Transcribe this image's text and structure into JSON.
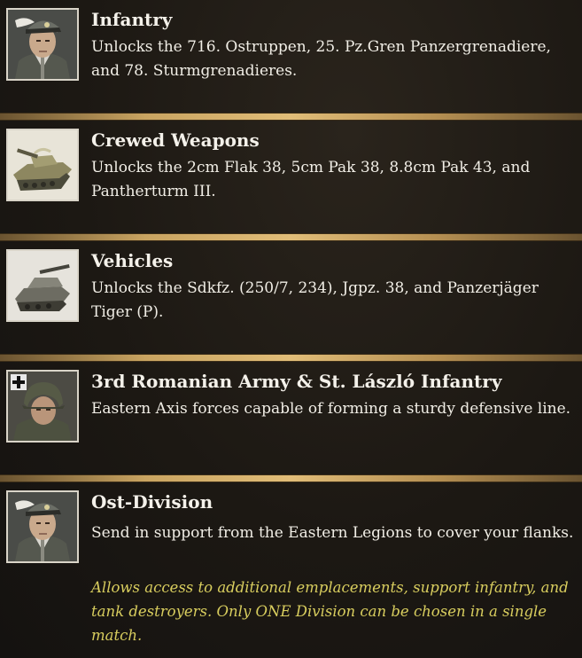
{
  "items": [
    {
      "icon": "officer-portrait-icon",
      "title": "Infantry",
      "description": "Unlocks the 716. Ostruppen, 25. Pz.Gren Panzergrenadiere, and 78. Sturmgrenadieres."
    },
    {
      "icon": "tank-icon",
      "title": "Crewed Weapons",
      "description": "Unlocks the 2cm Flak 38, 5cm Pak 38, 8.8cm Pak 43, and Pantherturm III."
    },
    {
      "icon": "tank-destroyer-icon",
      "title": "Vehicles",
      "description": "Unlocks the Sdkfz. (250/7, 234), Jgpz. 38, and Panzerjäger Tiger (P)."
    },
    {
      "icon": "soldier-portrait-icon",
      "title": "3rd Romanian Army & St. László Infantry",
      "description": "Eastern Axis forces capable of forming a sturdy defensive line."
    },
    {
      "icon": "officer-portrait-icon",
      "title": "Ost-Division",
      "description": "Send in support from the Eastern Legions to cover your flanks.",
      "note": "Allows access to additional emplacements, support infantry, and tank destroyers. Only ONE Division can be chosen in a single match."
    }
  ],
  "colors": {
    "divider": "#c9a461",
    "title": "#f4f1ea",
    "note": "#d8cd5e"
  }
}
